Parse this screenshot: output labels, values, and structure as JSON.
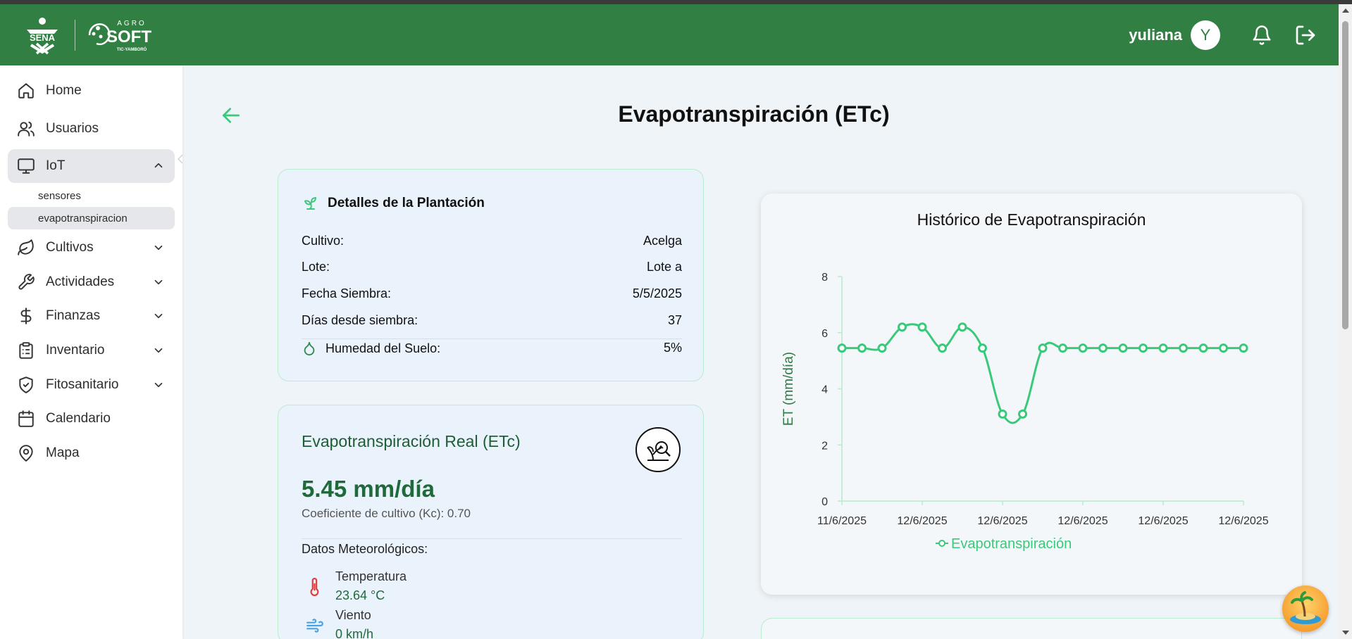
{
  "header": {
    "username": "yuliana",
    "avatar_initial": "Y",
    "brand_primary": "#317f43",
    "logo_sena_text": "SENA",
    "logo_agro_text": "AGRO",
    "logo_soft_text": "SOFT",
    "logo_tic_text": "TIC-YAMBORÓ"
  },
  "sidebar": {
    "items": [
      {
        "label": "Home",
        "icon": "home-icon"
      },
      {
        "label": "Usuarios",
        "icon": "users-icon"
      },
      {
        "label": "IoT",
        "icon": "monitor-icon",
        "expanded": true
      },
      {
        "label": "Cultivos",
        "icon": "leaf-icon"
      },
      {
        "label": "Actividades",
        "icon": "wrench-icon"
      },
      {
        "label": "Finanzas",
        "icon": "dollar-icon"
      },
      {
        "label": "Inventario",
        "icon": "clipboard-icon"
      },
      {
        "label": "Fitosanitario",
        "icon": "shield-icon"
      },
      {
        "label": "Calendario",
        "icon": "calendar-icon"
      },
      {
        "label": "Mapa",
        "icon": "map-pin-icon"
      }
    ],
    "iot_sub": [
      {
        "label": "sensores"
      },
      {
        "label": "evapotranspiracion",
        "active": true
      }
    ]
  },
  "page": {
    "title": "Evapotranspiración (ETc)"
  },
  "plantation": {
    "title": "Detalles de la Plantación",
    "rows": [
      {
        "k": "Cultivo:",
        "v": "Acelga"
      },
      {
        "k": "Lote:",
        "v": "Lote a"
      },
      {
        "k": "Fecha Siembra:",
        "v": "5/5/2025"
      },
      {
        "k": "Días desde siembra:",
        "v": "37"
      },
      {
        "k": "Humedad del Suelo:",
        "v": "5%"
      }
    ]
  },
  "etc": {
    "title": "Evapotranspiración Real (ETc)",
    "value": "5.45 mm/día",
    "kc": "Coeficiente de cultivo (Kc): 0.70",
    "meteo_title": "Datos Meteorológicos:",
    "meteo": [
      {
        "label": "Temperatura",
        "value": "23.64 °C",
        "icon": "thermometer-icon"
      },
      {
        "label": "Viento",
        "value": "0 km/h",
        "icon": "wind-icon"
      }
    ]
  },
  "chart_data": {
    "type": "line",
    "title": "Histórico de Evapotranspiración",
    "xlabel": "",
    "ylabel": "ET (mm/día)",
    "ylim": [
      0,
      8
    ],
    "yticks": [
      "0",
      "2",
      "4",
      "6",
      "8"
    ],
    "xtick_labels": [
      "11/6/2025",
      "12/6/2025",
      "12/6/2025",
      "12/6/2025",
      "12/6/2025",
      "12/6/2025"
    ],
    "series": [
      {
        "name": "Evapotranspiración",
        "color": "#3ac97a",
        "values": [
          5.45,
          5.45,
          5.45,
          6.2,
          6.2,
          5.45,
          6.2,
          5.45,
          3.1,
          3.1,
          5.45,
          5.45,
          5.45,
          5.45,
          5.45,
          5.45,
          5.45,
          5.45,
          5.45,
          5.45,
          5.45
        ]
      }
    ],
    "legend": "bottom",
    "grid": false
  }
}
